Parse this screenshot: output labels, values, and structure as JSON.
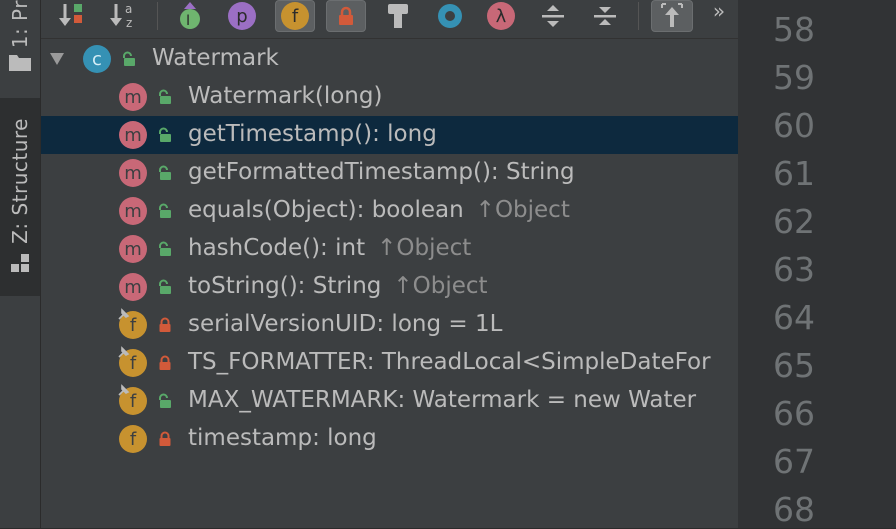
{
  "side_tabs": [
    {
      "label": "1: Pr",
      "icon": "folder-icon"
    },
    {
      "label": "Z: Structure",
      "icon": "structure-icon"
    }
  ],
  "toolbar": {
    "buttons": [
      {
        "name": "sort-by-visibility",
        "icon": "sort-visibility-icon",
        "pressed": false
      },
      {
        "name": "sort-alphabetically",
        "icon": "sort-alpha-icon",
        "label": "a z",
        "pressed": false
      },
      {
        "name": "show-inherited",
        "icon": "inherited-icon",
        "label": "I",
        "pressed": false
      },
      {
        "name": "show-properties",
        "icon": "properties-icon",
        "label": "p",
        "pressed": false
      },
      {
        "name": "show-fields",
        "icon": "fields-icon",
        "label": "f",
        "pressed": true
      },
      {
        "name": "show-non-public",
        "icon": "lock-icon",
        "pressed": true
      },
      {
        "name": "show-anonymous",
        "icon": "anonymous-icon",
        "pressed": false
      },
      {
        "name": "show-lambdas-circle",
        "icon": "circle-icon",
        "pressed": false
      },
      {
        "name": "show-lambdas",
        "icon": "lambda-icon",
        "label": "λ",
        "pressed": false
      },
      {
        "name": "expand-all",
        "icon": "expand-all-icon",
        "pressed": false
      },
      {
        "name": "collapse-all",
        "icon": "collapse-all-icon",
        "pressed": false
      },
      {
        "name": "autoscroll-from-source",
        "icon": "autoscroll-icon",
        "pressed": true
      },
      {
        "name": "more-actions",
        "icon": "chevron-more-icon",
        "label": "»",
        "pressed": false
      }
    ]
  },
  "tree": {
    "root": {
      "label": "Watermark",
      "kind": "c",
      "visibility": "public"
    },
    "items": [
      {
        "kind": "m",
        "visibility": "public",
        "label": "Watermark(long)",
        "suffix": ""
      },
      {
        "kind": "m",
        "visibility": "public",
        "label": "getTimestamp(): long",
        "suffix": "",
        "selected": true
      },
      {
        "kind": "m",
        "visibility": "public",
        "label": "getFormattedTimestamp(): String",
        "suffix": ""
      },
      {
        "kind": "m",
        "visibility": "public",
        "label": "equals(Object): boolean",
        "suffix": "↑Object"
      },
      {
        "kind": "m",
        "visibility": "public",
        "label": "hashCode(): int",
        "suffix": "↑Object"
      },
      {
        "kind": "m",
        "visibility": "public",
        "label": "toString(): String",
        "suffix": "↑Object"
      },
      {
        "kind": "f",
        "visibility": "private",
        "static": true,
        "label": "serialVersionUID: long = 1L",
        "suffix": ""
      },
      {
        "kind": "f",
        "visibility": "private",
        "static": true,
        "label": "TS_FORMATTER: ThreadLocal<SimpleDateFor",
        "suffix": ""
      },
      {
        "kind": "f",
        "visibility": "public",
        "static": true,
        "label": "MAX_WATERMARK: Watermark = new Water",
        "suffix": ""
      },
      {
        "kind": "f",
        "visibility": "private",
        "static": false,
        "label": "timestamp: long",
        "suffix": ""
      }
    ]
  },
  "gutter": {
    "line_numbers": [
      "58",
      "59",
      "60",
      "61",
      "62",
      "63",
      "64",
      "65",
      "66",
      "67",
      "68"
    ]
  },
  "colors": {
    "selection": "#0d293e",
    "method_icon": "#c86877",
    "field_icon": "#c7922f",
    "class_icon": "#3591b4",
    "public_icon": "#59a869",
    "private_icon": "#d25a3a"
  }
}
